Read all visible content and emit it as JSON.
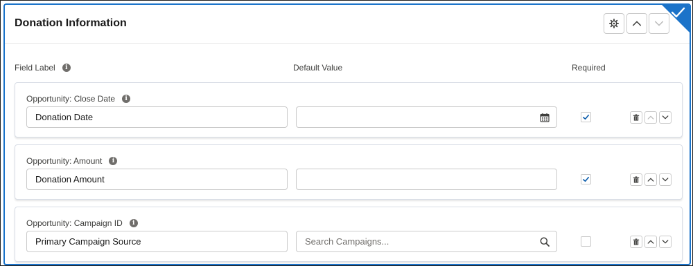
{
  "section": {
    "title": "Donation Information"
  },
  "columns": {
    "field_label": "Field Label",
    "default_value": "Default Value",
    "required": "Required"
  },
  "rows": [
    {
      "source_label": "Opportunity: Close Date",
      "field_label_value": "Donation Date",
      "default_value": "",
      "default_placeholder": "",
      "default_icon": "calendar-icon",
      "required": true
    },
    {
      "source_label": "Opportunity: Amount",
      "field_label_value": "Donation Amount",
      "default_value": "",
      "default_placeholder": "",
      "default_icon": "",
      "required": true
    },
    {
      "source_label": "Opportunity: Campaign ID",
      "field_label_value": "Primary Campaign Source",
      "default_value": "",
      "default_placeholder": "Search Campaigns...",
      "default_icon": "search-icon",
      "required": false
    }
  ],
  "colors": {
    "accent": "#1b73c9",
    "border": "#c9c9c9"
  }
}
